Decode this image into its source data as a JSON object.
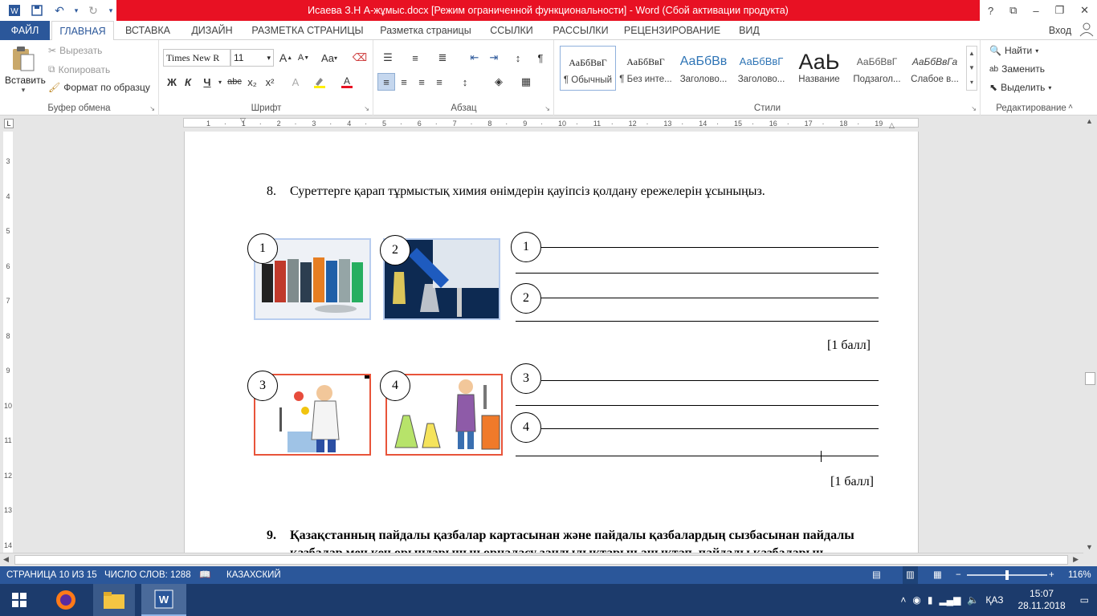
{
  "window": {
    "title": "Исаева З.Н   А-жұмыс.docx [Режим ограниченной функциональности] -  Word (Сбой активации продукта)",
    "controls": [
      "?",
      "⧉",
      "–",
      "❐",
      "✕"
    ]
  },
  "tabs": [
    "ФАЙЛ",
    "ГЛАВНАЯ",
    "ВСТАВКА",
    "ДИЗАЙН",
    "РАЗМЕТКА СТРАНИЦЫ",
    "Разметка страницы",
    "ССЫЛКИ",
    "РАССЫЛКИ",
    "РЕЦЕНЗИРОВАНИЕ",
    "ВИД"
  ],
  "account_label": "Вход",
  "clipboard": {
    "paste": "Вставить",
    "cut": "Вырезать",
    "copy": "Копировать",
    "format_painter": "Формат по образцу",
    "label": "Буфер обмена"
  },
  "font": {
    "name": "Times New R",
    "size": "11",
    "label": "Шрифт",
    "bold": "Ж",
    "italic": "К",
    "underline": "Ч",
    "strike": "abc",
    "sub": "x₂",
    "sup": "x²",
    "grow": "A",
    "shrink": "A",
    "case": "Aa"
  },
  "paragraph": {
    "label": "Абзац"
  },
  "styles": {
    "label": "Стили",
    "items": [
      {
        "sample": "АаБбВвГ",
        "name": "¶ Обычный"
      },
      {
        "sample": "АаБбВвГ",
        "name": "¶ Без инте..."
      },
      {
        "sample": "АаБбВв",
        "name": "Заголово..."
      },
      {
        "sample": "АаБбВвГ",
        "name": "Заголово..."
      },
      {
        "sample": "АаЬ",
        "name": "Название"
      },
      {
        "sample": "АаБбВвГ",
        "name": "Подзагол..."
      },
      {
        "sample": "АаБбВвГа",
        "name": "Слабое в..."
      }
    ]
  },
  "editing": {
    "find": "Найти",
    "replace": "Заменить",
    "select": "Выделить",
    "label": "Редактирование"
  },
  "ruler_h": [
    "1",
    "·",
    "1",
    "·",
    "2",
    "·",
    "3",
    "·",
    "4",
    "·",
    "5",
    "·",
    "6",
    "·",
    "7",
    "·",
    "8",
    "·",
    "9",
    "·",
    "10",
    "·",
    "11",
    "·",
    "12",
    "·",
    "13",
    "·",
    "14",
    "·",
    "15",
    "·",
    "16",
    "·",
    "17",
    "·",
    "18",
    "·",
    "19"
  ],
  "ruler_v": [
    "3",
    "4",
    "5",
    "6",
    "7",
    "8",
    "9",
    "10",
    "11",
    "12",
    "13",
    "14"
  ],
  "document": {
    "q8_num": "8.",
    "q8_text": "Суреттерге қарап тұрмыстық химия өнімдерін қауіпсіз қолдану ережелерін ұсыныңыз.",
    "pic_labels": [
      "1",
      "2",
      "3",
      "4"
    ],
    "answer_labels": [
      "1",
      "2",
      "3",
      "4"
    ],
    "score1": "[1 балл]",
    "score2": "[1 балл]",
    "q9_num": "9.",
    "q9_line1": "Қазақстанның пайдалы қазбалар картасынан және пайдалы қазбалардың сызбасынан пайдалы",
    "q9_line2": "қазбалар мен кен орындарының орналасу заңдылықтарын анықтап, пайдалы қазбаларын"
  },
  "status": {
    "page": "СТРАНИЦА 10 ИЗ 15",
    "words": "ЧИСЛО СЛОВ: 1288",
    "lang": "КАЗАХСКИЙ",
    "zoom": "116%"
  },
  "taskbar": {
    "lang": "ҚАЗ",
    "time": "15:07",
    "date": "28.11.2018"
  },
  "colors": {
    "accent": "#2b579a",
    "title_red": "#e81123",
    "taskbar": "#1c3b6c"
  }
}
